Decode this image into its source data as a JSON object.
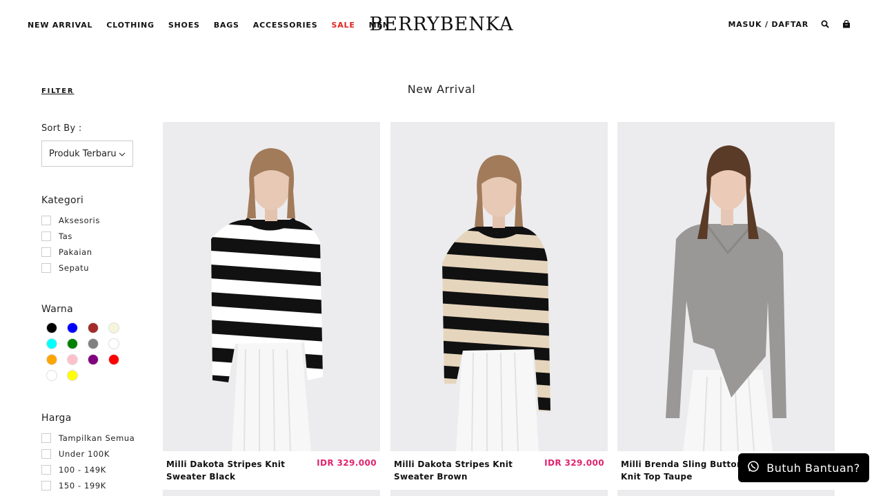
{
  "header": {
    "nav": [
      "NEW ARRIVAL",
      "CLOTHING",
      "SHOES",
      "BAGS",
      "ACCESSORIES",
      "SALE",
      "MEN"
    ],
    "logo": "BERRYBENKA",
    "auth": "MASUK / DAFTAR",
    "icons": [
      "search-icon",
      "shopping-bag-icon"
    ]
  },
  "page": {
    "title": "New Arrival"
  },
  "sidebar": {
    "filter": "FILTER",
    "sort_label": "Sort By :",
    "sort_value": "Produk Terbaru",
    "kategori_title": "Kategori",
    "kategori": [
      "Aksesoris",
      "Tas",
      "Pakaian",
      "Sepatu"
    ],
    "warna_title": "Warna",
    "colors": [
      "#000000",
      "#0000ff",
      "#a52a2a",
      "#f5f5dc",
      "#00ffff",
      "#008000",
      "#808080",
      "#ffffff",
      "#ffa500",
      "#ffc0cb",
      "#800080",
      "#ff0000",
      "#ffffff",
      "#ffff00"
    ],
    "harga_title": "Harga",
    "harga": [
      "Tampilkan Semua",
      "Under 100K",
      "100 - 149K",
      "150 - 199K"
    ]
  },
  "products": [
    {
      "name": "Milli Dakota Stripes Knit Sweater Black",
      "price": "IDR 329.000",
      "stripe_a": "#111111",
      "stripe_b": "#ffffff"
    },
    {
      "name": "Milli Dakota Stripes Knit Sweater Brown",
      "price": "IDR 329.000",
      "stripe_a": "#111111",
      "stripe_b": "#e6d5bd"
    },
    {
      "name": "Milli Brenda Sling Button Knit Top Taupe",
      "price": "",
      "stripe_a": "#9a9896",
      "stripe_b": "#9a9896"
    }
  ],
  "help": {
    "label": "Butuh Bantuan?"
  },
  "colors_ui": {
    "sale": "#e0231f",
    "price": "#e0236e"
  }
}
